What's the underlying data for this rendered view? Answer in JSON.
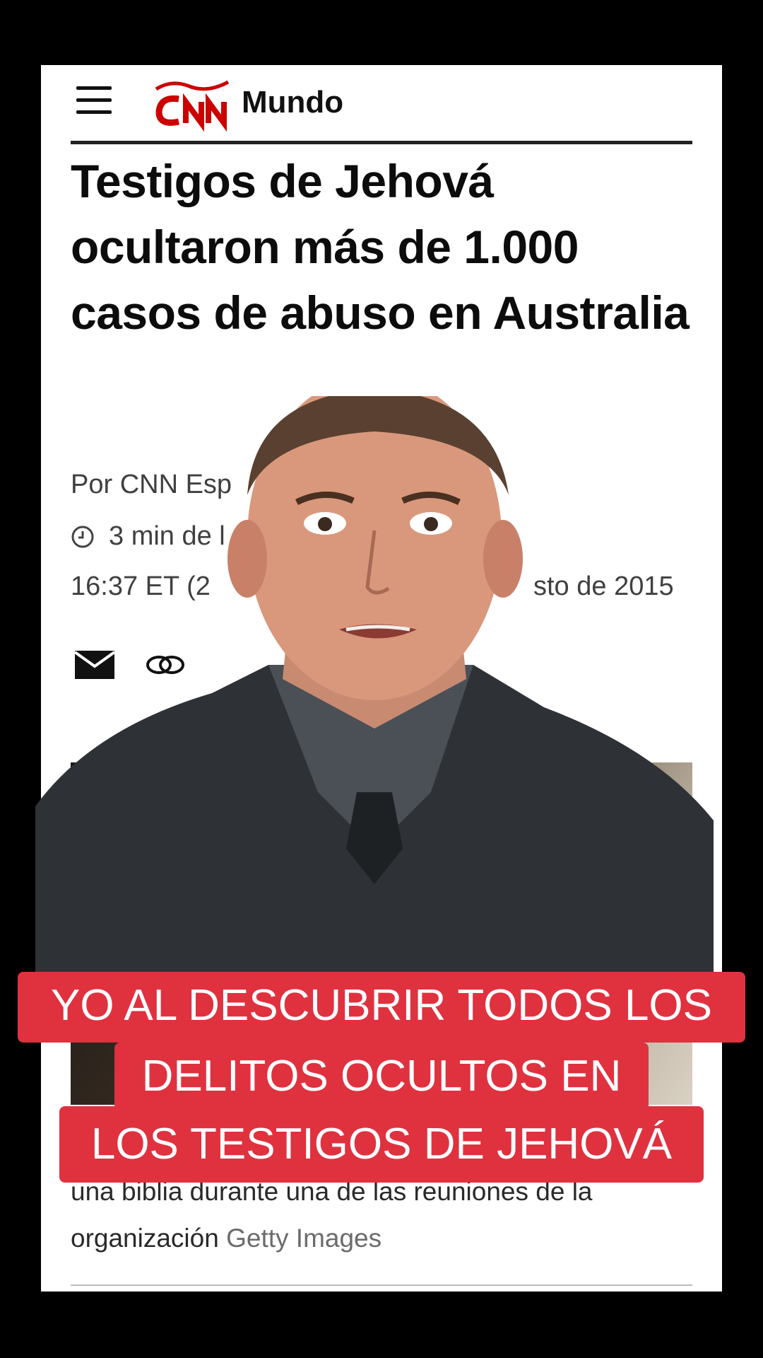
{
  "header": {
    "section": "Mundo",
    "logo": "CNN"
  },
  "article": {
    "headline": "Testigos de Jehová ocultaron más de 1.000 casos de abuso en Australia",
    "byline": "Por CNN Esp",
    "read_time": "3 min de l",
    "timestamp": "16:37 ET (2",
    "timestamp_end": "sto de 2015",
    "caption_text": "una biblia durante una de las reuniones de la organización",
    "caption_credit": "Getty Images"
  },
  "overlay": {
    "line1": "YO AL DESCUBRIR TODOS LOS",
    "line2": "DELITOS OCULTOS EN",
    "line3": "LOS TESTIGOS DE JEHOVÁ"
  },
  "colors": {
    "cnn_red": "#cc0000",
    "overlay_red": "#e0313f"
  },
  "icons": [
    "menu-icon",
    "clock-icon",
    "email-icon",
    "link-icon"
  ]
}
